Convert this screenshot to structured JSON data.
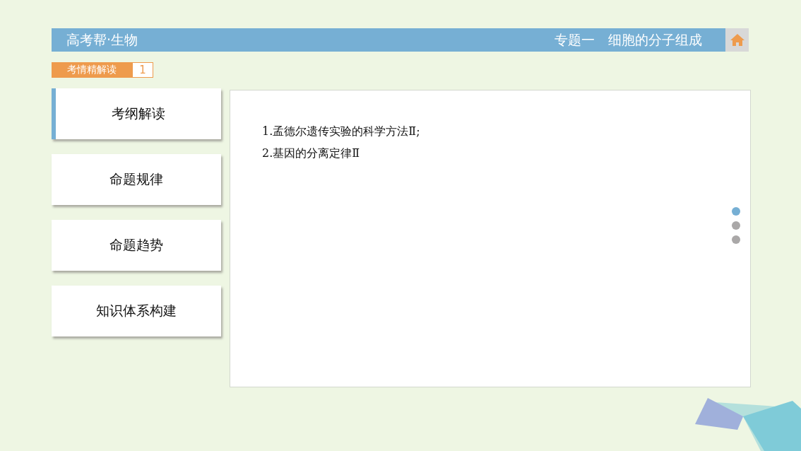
{
  "header": {
    "title": "高考帮·生物",
    "chapter": "专题一　细胞的分子组成"
  },
  "section_tag": {
    "label": "考情精解读",
    "number": "1"
  },
  "sidebar": {
    "items": [
      {
        "label": "考纲解读",
        "selected": true
      },
      {
        "label": "命题规律",
        "selected": false
      },
      {
        "label": "命题趋势",
        "selected": false
      },
      {
        "label": "知识体系构建",
        "selected": false
      }
    ]
  },
  "content": {
    "lines": [
      "1.孟德尔遗传实验的科学方法Ⅱ;",
      "2.基因的分离定律Ⅱ"
    ]
  },
  "pager": [
    {
      "selected": true
    },
    {
      "selected": false
    },
    {
      "selected": false
    }
  ]
}
